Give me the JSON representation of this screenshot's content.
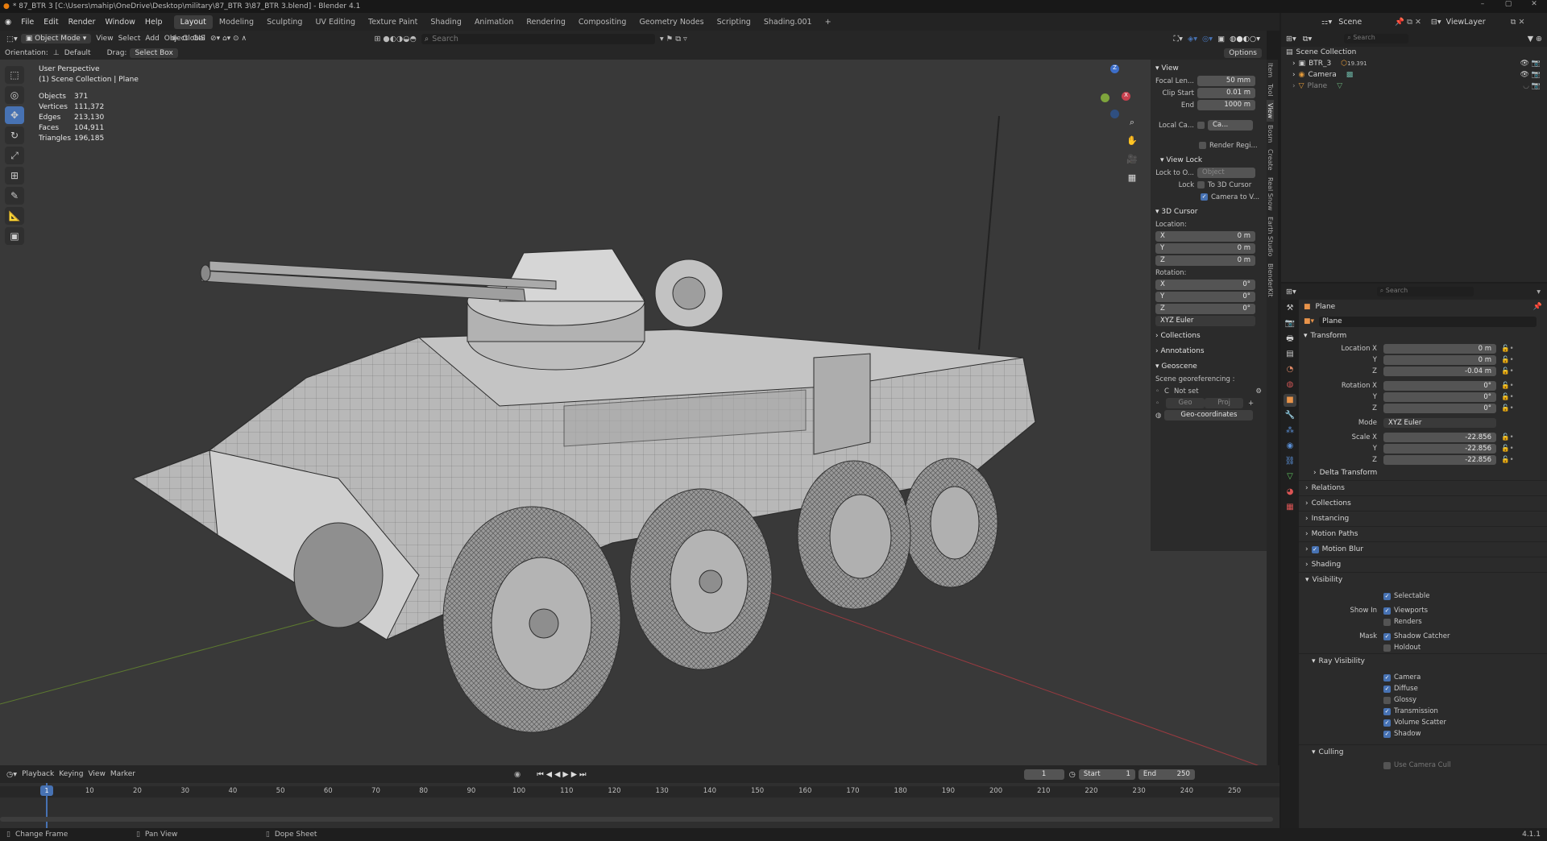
{
  "titlebar": {
    "title": "* 87_BTR 3 [C:\\Users\\mahip\\OneDrive\\Desktop\\military\\87_BTR 3\\87_BTR 3.blend] - Blender 4.1",
    "minimize": "–",
    "maximize": "▢",
    "close": "✕"
  },
  "menubar": {
    "items": [
      "File",
      "Edit",
      "Render",
      "Window",
      "Help"
    ],
    "workspaces": [
      "Layout",
      "Modeling",
      "Sculpting",
      "UV Editing",
      "Texture Paint",
      "Shading",
      "Animation",
      "Rendering",
      "Compositing",
      "Geometry Nodes",
      "Scripting",
      "Shading.001"
    ],
    "active_workspace": "Layout",
    "add_tab": "+"
  },
  "viewport_header": {
    "mode": "Object Mode",
    "menus": [
      "View",
      "Select",
      "Add",
      "Object",
      "GIS"
    ],
    "transform_space": "Global",
    "search_placeholder": "Search",
    "options": "Options"
  },
  "viewport_header2": {
    "orientation_label": "Orientation:",
    "orientation_value": "Default",
    "drag_label": "Drag:",
    "drag_value": "Select Box"
  },
  "viewport": {
    "perspective": "User Perspective",
    "collection": "(1) Scene Collection | Plane",
    "stats": [
      {
        "k": "Objects",
        "v": "371"
      },
      {
        "k": "Vertices",
        "v": "111,372"
      },
      {
        "k": "Edges",
        "v": "213,130"
      },
      {
        "k": "Faces",
        "v": "104,911"
      },
      {
        "k": "Triangles",
        "v": "196,185"
      }
    ],
    "gizmo": {
      "z": "Z",
      "x": "X",
      "y": "Y"
    }
  },
  "npanel": {
    "view_title": "View",
    "focal_label": "Focal Len...",
    "focal_value": "50 mm",
    "clip_start_label": "Clip Start",
    "clip_start_value": "0.01 m",
    "clip_end_label": "End",
    "clip_end_value": "1000 m",
    "local_camera_label": "Local Ca...",
    "local_camera_value": "Ca...",
    "render_region": "Render Regi...",
    "view_lock_title": "View Lock",
    "lock_to_object_label": "Lock to O...",
    "lock_to_object_value": "Object",
    "lock_label": "Lock",
    "lock_3d_cursor": "To 3D Cursor",
    "lock_camera": "Camera to V...",
    "cursor_title": "3D Cursor",
    "location_label": "Location:",
    "loc": [
      {
        "axis": "X",
        "val": "0 m"
      },
      {
        "axis": "Y",
        "val": "0 m"
      },
      {
        "axis": "Z",
        "val": "0 m"
      }
    ],
    "rotation_label": "Rotation:",
    "rot": [
      {
        "axis": "X",
        "val": "0°"
      },
      {
        "axis": "Y",
        "val": "0°"
      },
      {
        "axis": "Z",
        "val": "0°"
      }
    ],
    "rot_mode": "XYZ Euler",
    "collections": "Collections",
    "annotations": "Annotations",
    "geoscene": "Geoscene",
    "georef_label": "Scene georeferencing :",
    "crs_c": "C",
    "crs_value": "Not set",
    "geo_btn": "Geo",
    "proj_btn": "Proj",
    "geocoords_btn": "Geo-coordinates"
  },
  "ntabs": [
    "Item",
    "Tool",
    "View",
    "Bosm",
    "Create",
    "Real Snow",
    "Earth Studio",
    "BlenderKit"
  ],
  "outliner": {
    "scene_label": "Scene",
    "viewlayer_label": "ViewLayer",
    "search_placeholder": "Search",
    "root": "Scene Collection",
    "items": [
      {
        "name": "BTR_3",
        "extra": "19.391"
      },
      {
        "name": "Camera",
        "extra": ""
      },
      {
        "name": "Plane",
        "extra": ""
      }
    ]
  },
  "props_header": {
    "search_placeholder": "Search"
  },
  "props": {
    "object_name": "Plane",
    "data_name": "Plane",
    "transform_title": "Transform",
    "location": [
      {
        "label": "Location X",
        "val": "0 m"
      },
      {
        "label": "Y",
        "val": "0 m"
      },
      {
        "label": "Z",
        "val": "-0.04 m"
      }
    ],
    "rotation": [
      {
        "label": "Rotation X",
        "val": "0°"
      },
      {
        "label": "Y",
        "val": "0°"
      },
      {
        "label": "Z",
        "val": "0°"
      }
    ],
    "mode_label": "Mode",
    "mode_value": "XYZ Euler",
    "scale": [
      {
        "label": "Scale X",
        "val": "-22.856"
      },
      {
        "label": "Y",
        "val": "-22.856"
      },
      {
        "label": "Z",
        "val": "-22.856"
      }
    ],
    "delta_transform": "Delta Transform",
    "sections": [
      "Relations",
      "Collections",
      "Instancing",
      "Motion Paths",
      "Motion Blur",
      "Shading"
    ],
    "visibility_title": "Visibility",
    "selectable": "Selectable",
    "show_in_label": "Show In",
    "viewports": "Viewports",
    "renders": "Renders",
    "mask_label": "Mask",
    "shadow_catcher": "Shadow Catcher",
    "holdout": "Holdout",
    "ray_visibility_title": "Ray Visibility",
    "rays": [
      {
        "label": "Camera",
        "on": true
      },
      {
        "label": "Diffuse",
        "on": true
      },
      {
        "label": "Glossy",
        "on": false
      },
      {
        "label": "Transmission",
        "on": true
      },
      {
        "label": "Volume Scatter",
        "on": true
      },
      {
        "label": "Shadow",
        "on": true
      }
    ],
    "culling_title": "Culling",
    "use_camera_cull": "Use Camera Cull"
  },
  "timeline": {
    "menus": [
      "Playback",
      "Keying",
      "View",
      "Marker"
    ],
    "current_frame": "1",
    "start_label": "Start",
    "start_value": "1",
    "end_label": "End",
    "end_value": "250",
    "ticks": [
      "1",
      "10",
      "20",
      "30",
      "40",
      "50",
      "60",
      "70",
      "80",
      "90",
      "100",
      "110",
      "120",
      "130",
      "140",
      "150",
      "160",
      "170",
      "180",
      "190",
      "200",
      "210",
      "220",
      "230",
      "240",
      "250"
    ]
  },
  "statusbar": {
    "left": "Change Frame",
    "mid": "Pan View",
    "right": "Dope Sheet",
    "version": "4.1.1"
  },
  "colors": {
    "accent": "#4772b3",
    "viewport_bg": "#393939",
    "x_axis": "#c8404e",
    "y_axis": "#7ea43c",
    "z_axis": "#3d6ec9"
  }
}
